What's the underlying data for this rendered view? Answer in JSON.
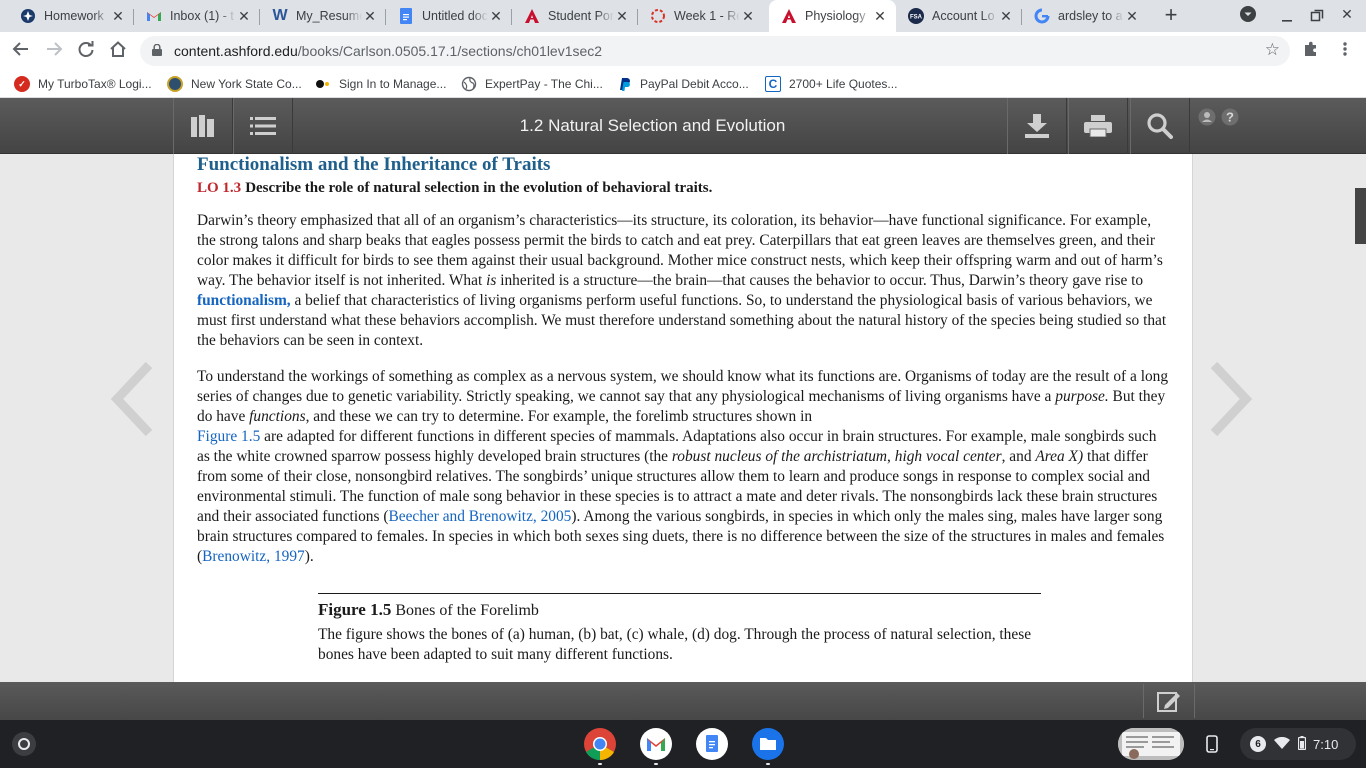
{
  "tabs": [
    {
      "label": "Homework",
      "icon": "homework-favicon-icon",
      "active": false
    },
    {
      "label": "Inbox (1) - t",
      "icon": "gmail-favicon-icon",
      "active": false
    },
    {
      "label": "My_Resume",
      "icon": "word-favicon-icon",
      "active": false
    },
    {
      "label": "Untitled doc",
      "icon": "docs-favicon-icon",
      "active": false
    },
    {
      "label": "Student Por",
      "icon": "ashford-favicon-icon",
      "active": false
    },
    {
      "label": "Week 1 - Re",
      "icon": "loading-favicon-icon",
      "active": false
    },
    {
      "label": "Physiology",
      "icon": "ashford-favicon-icon",
      "active": true
    },
    {
      "label": "Account Lo",
      "icon": "fsa-favicon-icon",
      "active": false
    },
    {
      "label": "ardsley to a",
      "icon": "google-favicon-icon",
      "active": false
    }
  ],
  "address": {
    "domain": "content.ashford.edu",
    "path": "/books/Carlson.0505.17.1/sections/ch01lev1sec2"
  },
  "bookmarks": [
    {
      "label": "My TurboTax® Logi...",
      "icon": "turbotax-icon",
      "color": "#d52b1e"
    },
    {
      "label": "New York State Co...",
      "icon": "nys-seal-icon",
      "color": "#2f4f6f"
    },
    {
      "label": "Sign In to Manage...",
      "icon": "manage-icon",
      "color": "#111111"
    },
    {
      "label": "ExpertPay - The Chi...",
      "icon": "globe-icon",
      "color": "#5f6368"
    },
    {
      "label": "PayPal Debit Acco...",
      "icon": "paypal-icon",
      "color": "#003087"
    },
    {
      "label": "2700+ Life Quotes...",
      "icon": "quotes-icon",
      "color": "#1565c0"
    }
  ],
  "reader": {
    "section_title": "1.2 Natural Selection and Evolution"
  },
  "content": {
    "heading": "Functionalism and the Inheritance of Traits",
    "lo_tag": "LO 1.3",
    "lo_text": "Describe the role of natural selection in the evolution of behavioral traits.",
    "p1_a": "Darwin’s theory emphasized that all of an organism’s characteristics—its structure, its coloration, its behavior—have functional significance. For example, the strong talons and sharp beaks that eagles possess permit the birds to catch and eat prey. Caterpillars that eat green leaves are themselves green, and their color makes it difficult for birds to see them against their usual background. Mother mice construct nests, which keep their offspring warm and out of harm’s way. The behavior itself is not inherited. What ",
    "p1_is": "is",
    "p1_b": " inherited is a structure—the brain—that causes the behavior to occur. Thus, Darwin’s theory gave rise to ",
    "p1_link": "functionalism,",
    "p1_c": " a belief that characteristics of living organisms perform useful functions. So, to understand the physiological basis of various behaviors, we must first understand what these behaviors accomplish. We must therefore understand something about the natural history of the species being studied so that the behaviors can be seen in context.",
    "p2_a": "To understand the workings of something as complex as a nervous system, we should know what its functions are. Organisms of today are the result of a long series of changes due to genetic variability. Strictly speaking, we cannot say that any physiological mechanisms of living organisms have a ",
    "p2_purpose": "purpose.",
    "p2_b": " But they do have ",
    "p2_functions": "functions",
    "p2_c": ", and these we can try to determine. For example, the forelimb structures shown in ",
    "p2_fig_link": "Figure 1.5",
    "p2_d": " are adapted for different functions in different species of mammals. Adaptations also occur in brain structures. For example, male songbirds such as the white crowned sparrow possess highly developed brain structures (the ",
    "p2_robust": "robust nucleus of the archistriatum",
    "p2_e": ", ",
    "p2_hvc": "high vocal center",
    "p2_f": ", and ",
    "p2_areax": "Area X)",
    "p2_g": " that differ from some of their close, nonsongbird relatives. The songbirds’ unique structures allow them to learn and produce songs in response to complex social and environmental stimuli. The function of male song behavior in these species is to attract a mate and deter rivals. The nonsongbirds lack these brain structures and their associated functions (",
    "p2_cite1": "Beecher and Brenowitz, 2005",
    "p2_h": "). Among the various songbirds, in species in which only the males sing, males have larger song brain structures compared to females. In species in which both sexes sing duets, there is no difference between the size of the structures in males and females (",
    "p2_cite2": "Brenowitz, 1997",
    "p2_i": ").",
    "figure_label": "Figure 1.5",
    "figure_title": "Bones of the Forelimb",
    "figure_caption": "The figure shows the bones of (a) human, (b) bat, (c) whale, (d) dog. Through the process of natural selection, these bones have been adapted to suit many different functions."
  },
  "shelf": {
    "notification_count": "6",
    "time": "7:10"
  },
  "colors": {
    "heading": "#1f5f8b",
    "lo_tag": "#c0282d",
    "link": "#1565c0",
    "reader_bar": "#4d4d4d"
  }
}
